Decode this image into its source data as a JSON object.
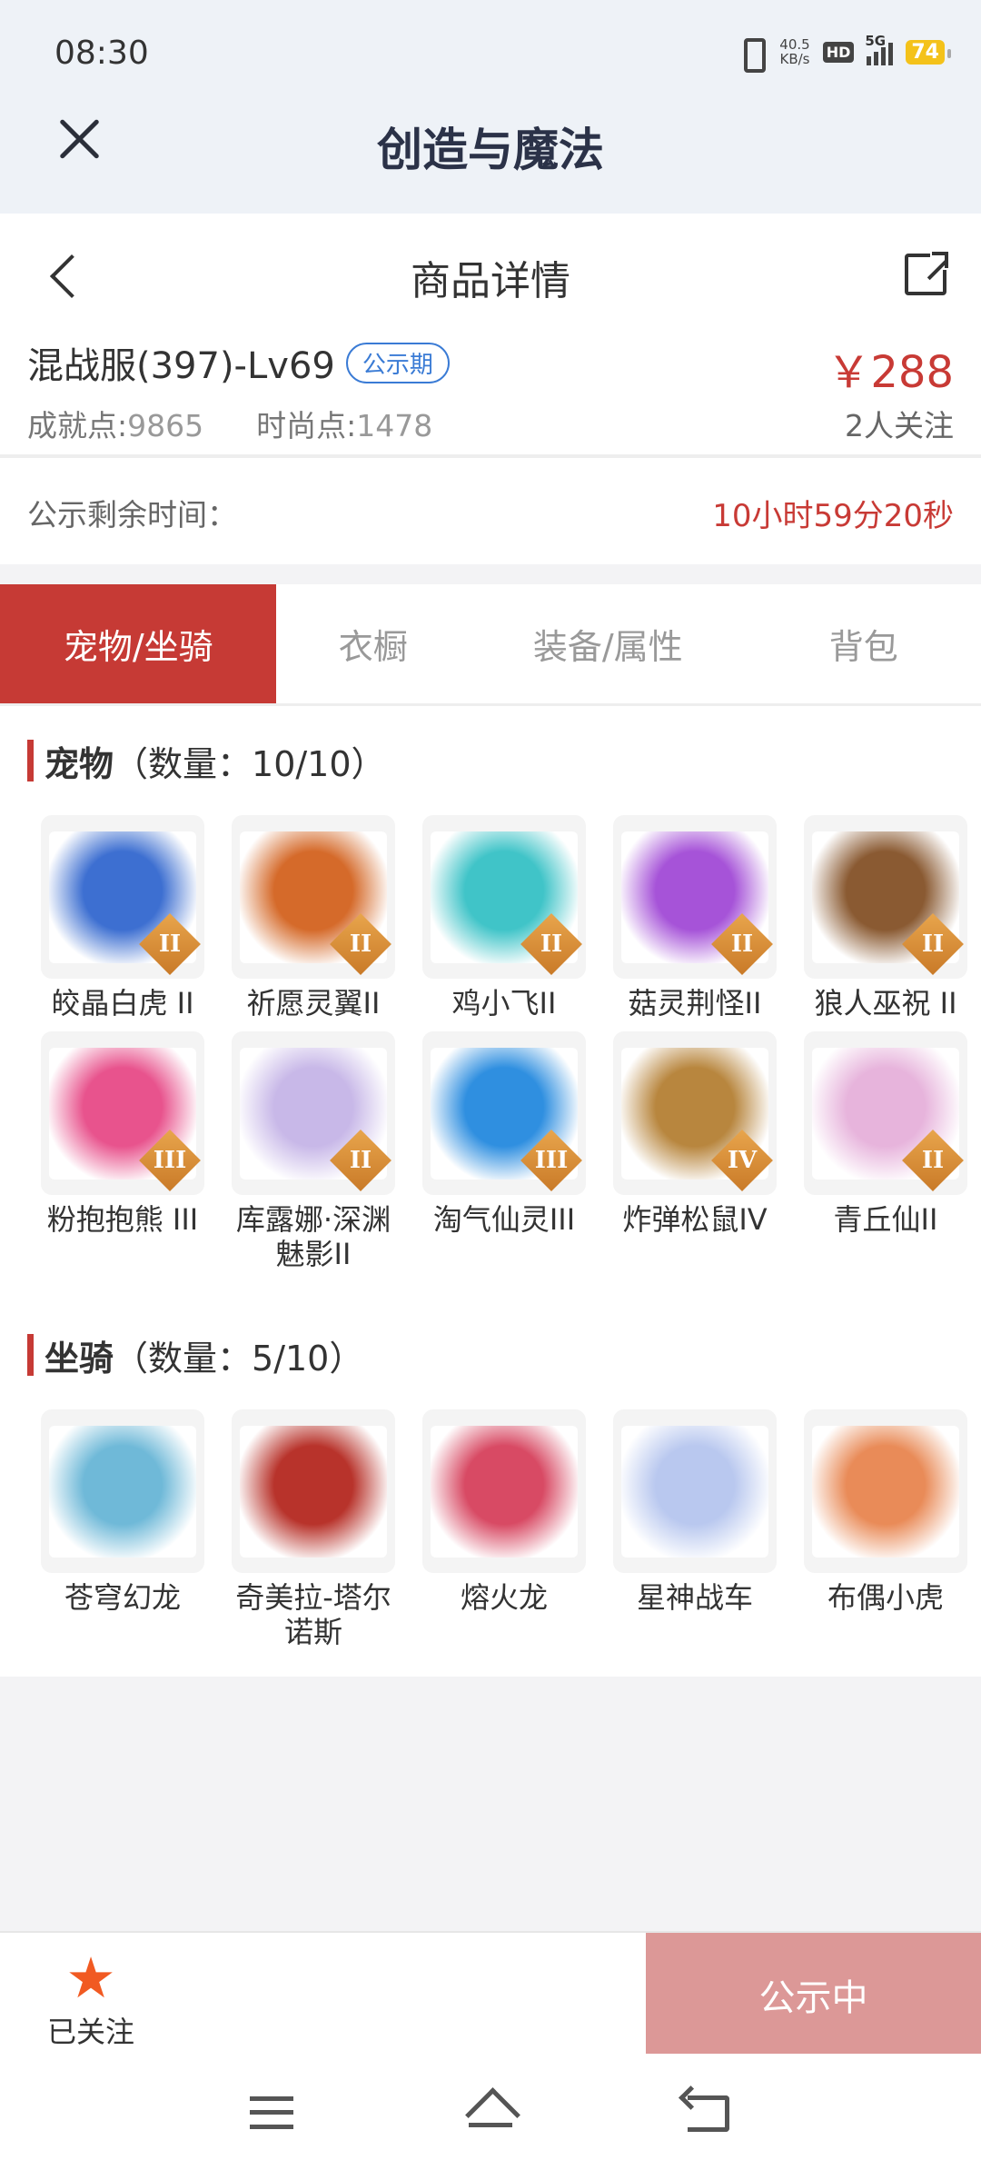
{
  "status": {
    "time": "08:30",
    "speed_top": "40.5",
    "speed_bottom": "KB/s",
    "hd": "HD",
    "net": "5G",
    "battery": "74"
  },
  "app": {
    "title": "创造与魔法"
  },
  "nav": {
    "title": "商品详情"
  },
  "listing": {
    "server": "混战服(397)-Lv69",
    "badge": "公示期",
    "achievement_label": "成就点:",
    "achievement_value": "9865",
    "fashion_label": "时尚点:",
    "fashion_value": "1478",
    "price": "￥288",
    "followers": "2人关注"
  },
  "timer": {
    "label": "公示剩余时间：",
    "value": "10小时59分20秒"
  },
  "tabs": [
    {
      "label": "宠物/坐骑",
      "active": true
    },
    {
      "label": "衣橱"
    },
    {
      "label": "装备/属性"
    },
    {
      "label": "背包"
    }
  ],
  "pets": {
    "title": "宠物",
    "count": "（数量：10/10）",
    "items": [
      {
        "name": "皎晶白虎 II",
        "rank": "II",
        "icon": "white-tiger-icon",
        "color": "#3d6fd1"
      },
      {
        "name": "祈愿灵翼II",
        "rank": "II",
        "icon": "eagle-icon",
        "color": "#d56a2a"
      },
      {
        "name": "鸡小飞II",
        "rank": "II",
        "icon": "chick-icon",
        "color": "#40c4c8"
      },
      {
        "name": "菇灵荆怪II",
        "rank": "II",
        "icon": "mushroom-sprite-icon",
        "color": "#a653d8"
      },
      {
        "name": "狼人巫祝 II",
        "rank": "II",
        "icon": "werewolf-icon",
        "color": "#8a5a32"
      },
      {
        "name": "粉抱抱熊 III",
        "rank": "III",
        "icon": "pink-bear-icon",
        "color": "#e8538d"
      },
      {
        "name": "库露娜·深渊魅影II",
        "rank": "II",
        "icon": "kuluna-icon",
        "color": "#c8b8e8"
      },
      {
        "name": "淘气仙灵III",
        "rank": "III",
        "icon": "blue-dog-icon",
        "color": "#2f8fe0"
      },
      {
        "name": "炸弹松鼠IV",
        "rank": "IV",
        "icon": "squirrel-icon",
        "color": "#b8863e"
      },
      {
        "name": "青丘仙II",
        "rank": "II",
        "icon": "fox-fairy-icon",
        "color": "#e7b4dc"
      }
    ]
  },
  "mounts": {
    "title": "坐骑",
    "count": "（数量：5/10）",
    "items": [
      {
        "name": "苍穹幻龙",
        "icon": "sky-dragon-icon",
        "color": "#6fb9d8"
      },
      {
        "name": "奇美拉-塔尔诺斯",
        "icon": "chimera-icon",
        "color": "#b8332b"
      },
      {
        "name": "熔火龙",
        "icon": "lava-dragon-icon",
        "color": "#d84a64"
      },
      {
        "name": "星神战车",
        "icon": "star-horse-icon",
        "color": "#b9c8ef"
      },
      {
        "name": "布偶小虎",
        "icon": "doll-tiger-icon",
        "color": "#e98b58"
      }
    ]
  },
  "bottom": {
    "follow_label": "已关注",
    "public_button": "公示中"
  },
  "colors": {
    "accent": "#c63a35",
    "price": "#c83a35",
    "badge": "#3a7bd5",
    "star": "#f15a22",
    "button": "#dc9897"
  }
}
